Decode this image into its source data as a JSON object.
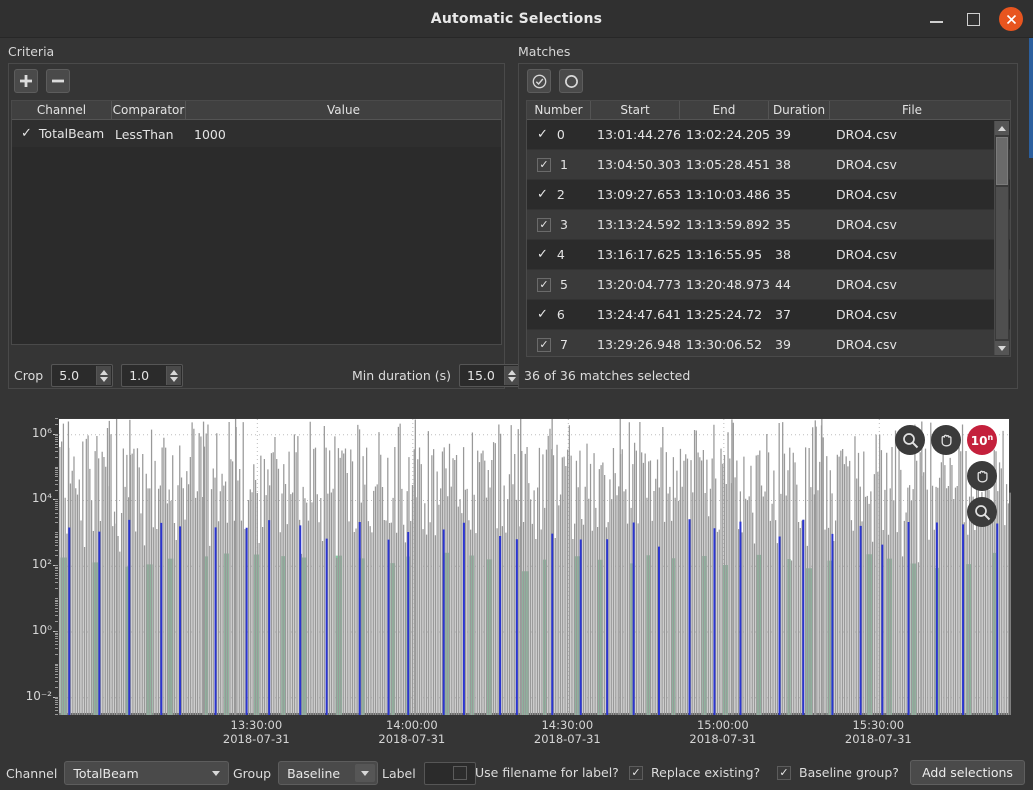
{
  "window": {
    "title": "Automatic Selections",
    "buttons": {
      "minimize": "minimize-button",
      "maximize": "maximize-button",
      "close": "close-button"
    },
    "accent_close": "#e8551f"
  },
  "criteria": {
    "section_label": "Criteria",
    "toolbar": {
      "add_label": "+",
      "remove_label": "−"
    },
    "columns": [
      "Channel",
      "Comparator",
      "Value"
    ],
    "rows": [
      {
        "checked": true,
        "channel": "TotalBeam",
        "comparator": "LessThan",
        "value": "1000"
      }
    ],
    "crop": {
      "label": "Crop",
      "value_1": "5.0",
      "value_2": "1.0"
    },
    "min_duration": {
      "label": "Min duration (s)",
      "value": "15.0"
    }
  },
  "matches": {
    "section_label": "Matches",
    "toolbar": {
      "select_all_icon": "check-circle-icon",
      "deselect_all_icon": "circle-icon"
    },
    "columns": [
      "Number",
      "Start",
      "End",
      "Duration",
      "File"
    ],
    "rows": [
      {
        "checked": true,
        "number": "0",
        "start": "13:01:44.276",
        "end": "13:02:24.205",
        "duration": "39",
        "file": "DRO4.csv"
      },
      {
        "checked": true,
        "number": "1",
        "start": "13:04:50.303",
        "end": "13:05:28.451",
        "duration": "38",
        "file": "DRO4.csv"
      },
      {
        "checked": true,
        "number": "2",
        "start": "13:09:27.653",
        "end": "13:10:03.486",
        "duration": "35",
        "file": "DRO4.csv"
      },
      {
        "checked": true,
        "number": "3",
        "start": "13:13:24.592",
        "end": "13:13:59.892",
        "duration": "35",
        "file": "DRO4.csv"
      },
      {
        "checked": true,
        "number": "4",
        "start": "13:16:17.625",
        "end": "13:16:55.95",
        "duration": "38",
        "file": "DRO4.csv"
      },
      {
        "checked": true,
        "number": "5",
        "start": "13:20:04.773",
        "end": "13:20:48.973",
        "duration": "44",
        "file": "DRO4.csv"
      },
      {
        "checked": true,
        "number": "6",
        "start": "13:24:47.641",
        "end": "13:25:24.72",
        "duration": "37",
        "file": "DRO4.csv"
      },
      {
        "checked": true,
        "number": "7",
        "start": "13:29:26.948",
        "end": "13:30:06.52",
        "duration": "39",
        "file": "DRO4.csv"
      }
    ],
    "status": "36 of 36 matches selected"
  },
  "chart_data": {
    "type": "line",
    "title": "",
    "xlabel": "",
    "ylabel": "",
    "yscale": "log",
    "ylim": [
      0.003,
      3000000
    ],
    "ytick_labels": [
      "10⁶",
      "10⁴",
      "10²",
      "10⁰",
      "10⁻²"
    ],
    "ytick_values": [
      1000000,
      10000,
      100,
      1,
      0.01
    ],
    "xtick_labels": [
      {
        "time": "13:30:00",
        "date": "2018-07-31"
      },
      {
        "time": "14:00:00",
        "date": "2018-07-31"
      },
      {
        "time": "14:30:00",
        "date": "2018-07-31"
      },
      {
        "time": "15:00:00",
        "date": "2018-07-31"
      },
      {
        "time": "15:30:00",
        "date": "2018-07-31"
      }
    ],
    "xlim": [
      "13:10:00 2018-07-31",
      "15:45:00 2018-07-31"
    ],
    "grid": true,
    "legend_position": "none",
    "series": [
      {
        "name": "TotalBeam",
        "color": "#999999",
        "style": "dense-vertical-trace"
      },
      {
        "name": "Selection markers",
        "color": "#2b35d0",
        "style": "vertical-bars"
      },
      {
        "name": "Baseline",
        "color": "#86cba2",
        "style": "vertical-bars"
      }
    ],
    "overlay_buttons": [
      {
        "name": "zoom-tool",
        "icon": "magnifier-icon",
        "label": "",
        "active": false
      },
      {
        "name": "pan-tool",
        "icon": "hand-icon",
        "label": "",
        "active": false
      },
      {
        "name": "log-scale-tool",
        "icon": "power-icon",
        "label": "10",
        "exponent": "n",
        "active": true,
        "color": "#c4203c"
      },
      {
        "name": "pan-tool-secondary",
        "icon": "hand-icon",
        "label": "",
        "active": false
      },
      {
        "name": "zoom-tool-secondary",
        "icon": "magnifier-icon",
        "label": "",
        "active": false
      }
    ]
  },
  "bottom": {
    "channel_label": "Channel",
    "channel_value": "TotalBeam",
    "group_label": "Group",
    "group_value": "Baseline",
    "label_label": "Label",
    "label_value": "",
    "use_filename_label": "Use filename for label?",
    "use_filename_checked": false,
    "replace_existing_label": "Replace existing?",
    "replace_existing_checked": true,
    "baseline_group_label": "Baseline group?",
    "baseline_group_checked": true,
    "add_selections_label": "Add selections"
  }
}
